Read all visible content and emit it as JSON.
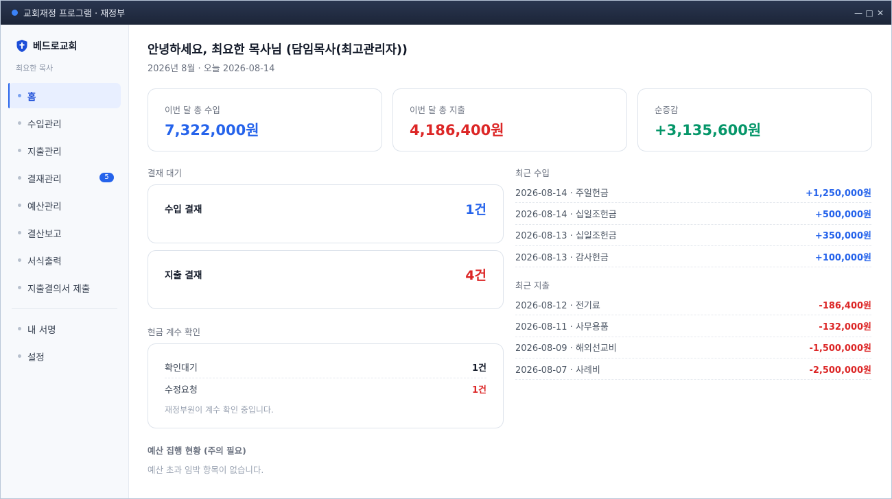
{
  "window": {
    "title": "교회재정 프로그램 · 재정부",
    "controls": {
      "minimize": "—",
      "maximize": "□",
      "close": "✕"
    }
  },
  "sidebar": {
    "church_name": "베드로교회",
    "user_name": "최요한 목사",
    "items": [
      {
        "label": "홈",
        "active": true
      },
      {
        "label": "수입관리"
      },
      {
        "label": "지출관리"
      },
      {
        "label": "결재관리",
        "badge": "5"
      },
      {
        "label": "예산관리"
      },
      {
        "label": "결산보고"
      },
      {
        "label": "서식출력"
      },
      {
        "label": "지출결의서 제출"
      }
    ],
    "bottom_items": [
      {
        "label": "내 서명"
      },
      {
        "label": "설정"
      }
    ]
  },
  "header": {
    "greeting": "안녕하세요, 최요한 목사님 (담임목사(최고관리자))",
    "date_line": "2026년 8월 · 오늘 2026-08-14"
  },
  "stats": [
    {
      "label": "이번 달 총 수입",
      "value": "7,322,000원",
      "color": "#2563eb"
    },
    {
      "label": "이번 달 총 지출",
      "value": "4,186,400원",
      "color": "#dc2626"
    },
    {
      "label": "순증감",
      "value": "+3,135,600원",
      "color": "#059669"
    }
  ],
  "approvals": {
    "title": "결재 대기",
    "items": [
      {
        "label": "수입 결재",
        "count": "1건",
        "color": "#2563eb"
      },
      {
        "label": "지출 결재",
        "count": "4건",
        "color": "#dc2626"
      }
    ]
  },
  "cash_check": {
    "title": "현금 계수 확인",
    "rows": [
      {
        "label": "확인대기",
        "value": "1건",
        "color": "#111827"
      },
      {
        "label": "수정요청",
        "value": "1건",
        "color": "#dc2626"
      }
    ],
    "note": "재정부원이 계수 확인 중입니다."
  },
  "budget": {
    "title": "예산 집행 현황 (주의 필요)",
    "note": "예산 초과 임박 항목이 없습니다."
  },
  "recent_income": {
    "title": "최근 수입",
    "rows": [
      {
        "desc": "2026-08-14 · 주일헌금",
        "amount": "+1,250,000원"
      },
      {
        "desc": "2026-08-14 · 십일조헌금",
        "amount": "+500,000원"
      },
      {
        "desc": "2026-08-13 · 십일조헌금",
        "amount": "+350,000원"
      },
      {
        "desc": "2026-08-13 · 감사헌금",
        "amount": "+100,000원"
      }
    ]
  },
  "recent_expense": {
    "title": "최근 지출",
    "rows": [
      {
        "desc": "2026-08-12 · 전기료",
        "amount": "-186,400원"
      },
      {
        "desc": "2026-08-11 · 사무용품",
        "amount": "-132,000원"
      },
      {
        "desc": "2026-08-09 · 해외선교비",
        "amount": "-1,500,000원"
      },
      {
        "desc": "2026-08-07 · 사례비",
        "amount": "-2,500,000원"
      }
    ]
  }
}
